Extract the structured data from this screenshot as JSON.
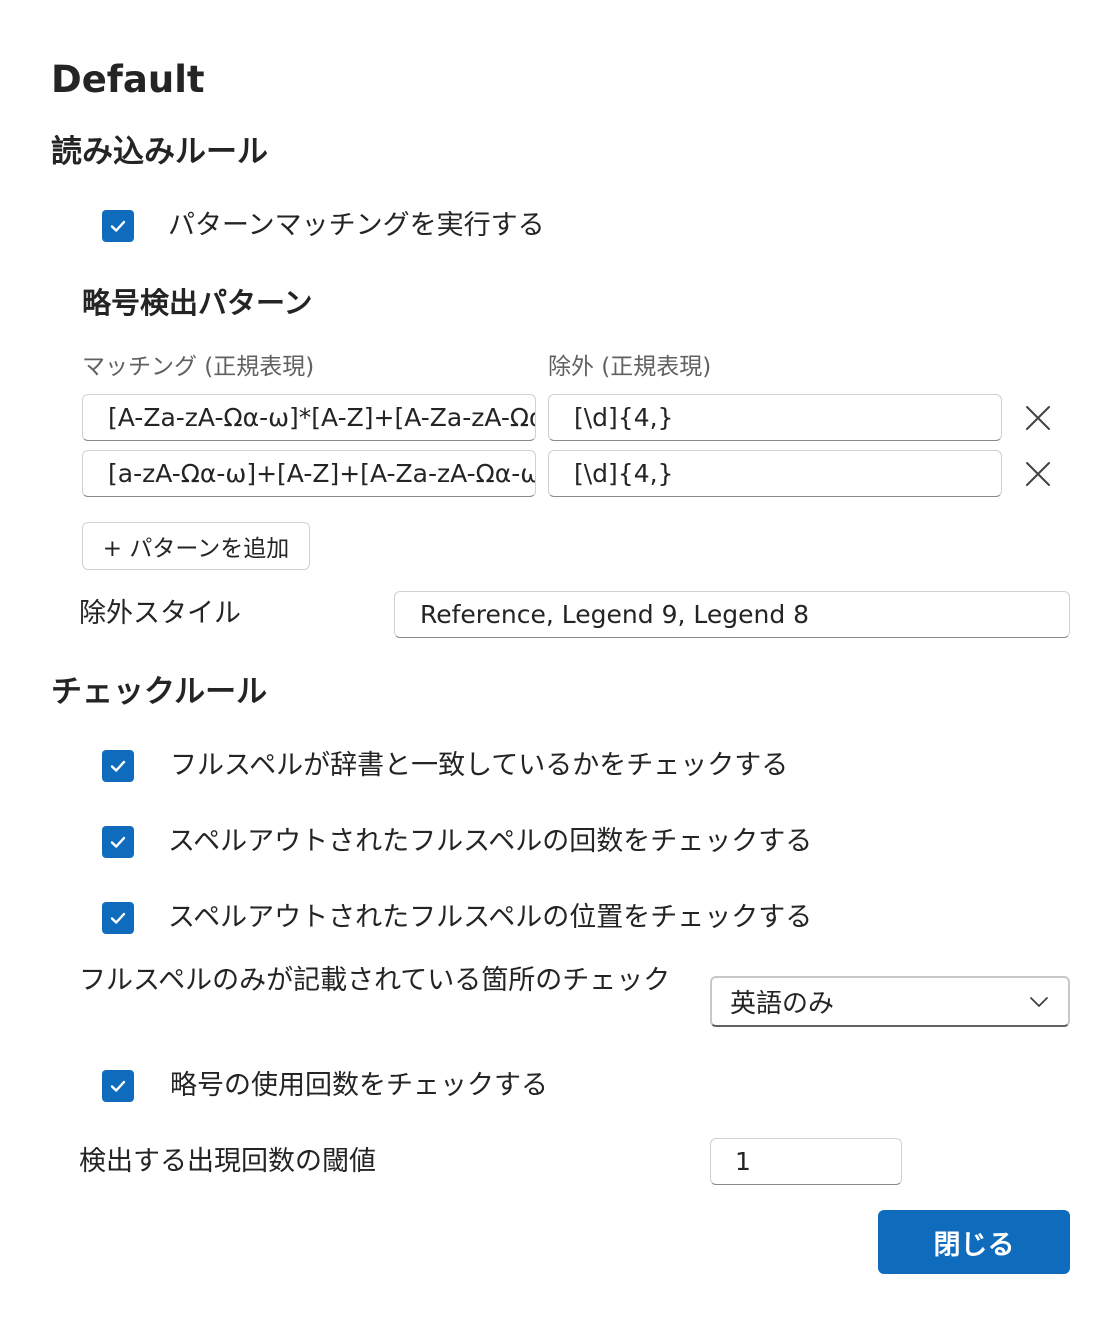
{
  "dialog": {
    "title": "Default"
  },
  "read_rules": {
    "title": "読み込みルール",
    "pattern_matching": {
      "label": "パターンマッチングを実行する",
      "checked": true
    },
    "abbr_pattern": {
      "title": "略号検出パターン",
      "match_header": "マッチング (正規表現)",
      "exclude_header": "除外 (正規表現)",
      "rows": [
        {
          "match": "[A-Za-zA-Ωα-ω]*[A-Z]+[A-Za-zA-Ωα-ω]*",
          "exclude": "[\\d]{4,}"
        },
        {
          "match": "[a-zA-Ωα-ω]+[A-Z]+[A-Za-zA-Ωα-ω]*",
          "exclude": "[\\d]{4,}"
        }
      ],
      "add_label": "+ パターンを追加"
    },
    "exclude_style": {
      "label": "除外スタイル",
      "value": "Reference, Legend 9, Legend 8"
    }
  },
  "check_rules": {
    "title": "チェックルール",
    "items": [
      {
        "label": "フルスペルが辞書と一致しているかをチェックする",
        "checked": true
      },
      {
        "label": "スペルアウトされたフルスペルの回数をチェックする",
        "checked": true
      },
      {
        "label": "スペルアウトされたフルスペルの位置をチェックする",
        "checked": true
      }
    ],
    "fullspell_only": {
      "label": "フルスペルのみが記載されている箇所のチェック",
      "selected": "英語のみ"
    },
    "abbr_usage": {
      "label": "略号の使用回数をチェックする",
      "checked": true
    },
    "threshold": {
      "label": "検出する出現回数の閾値",
      "value": "1"
    }
  },
  "footer": {
    "close_label": "閉じる"
  },
  "colors": {
    "accent": "#0f6cbd"
  }
}
